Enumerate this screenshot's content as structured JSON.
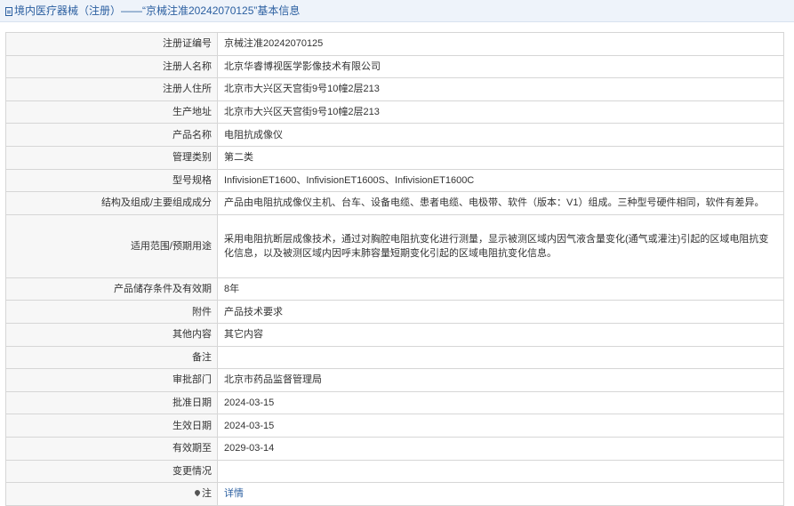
{
  "header": {
    "title": "境内医疗器械（注册）——“京械注准20242070125”基本信息",
    "icon": "document-icon"
  },
  "rows": [
    {
      "label": "注册证编号",
      "value": "京械注准20242070125"
    },
    {
      "label": "注册人名称",
      "value": "北京华睿博视医学影像技术有限公司"
    },
    {
      "label": "注册人住所",
      "value": "北京市大兴区天宫街9号10幢2层213"
    },
    {
      "label": "生产地址",
      "value": "北京市大兴区天宫街9号10幢2层213"
    },
    {
      "label": "产品名称",
      "value": "电阻抗成像仪"
    },
    {
      "label": "管理类别",
      "value": "第二类"
    },
    {
      "label": "型号规格",
      "value": "InfivisionET1600、InfivisionET1600S、InfivisionET1600C"
    },
    {
      "label": "结构及组成/主要组成成分",
      "value": "产品由电阻抗成像仪主机、台车、设备电缆、患者电缆、电极带、软件（版本：V1）组成。三种型号硬件相同，软件有差异。"
    },
    {
      "label": "适用范围/预期用途",
      "value": "采用电阻抗断层成像技术，通过对胸腔电阻抗变化进行测量，显示被测区域内因气液含量变化(通气或灌注)引起的区域电阻抗变化信息，以及被测区域内因呼末肺容量短期变化引起的区域电阻抗变化信息。"
    },
    {
      "label": "产品储存条件及有效期",
      "value": "8年"
    },
    {
      "label": "附件",
      "value": "产品技术要求"
    },
    {
      "label": "其他内容",
      "value": "其它内容"
    },
    {
      "label": "备注",
      "value": ""
    },
    {
      "label": "审批部门",
      "value": "北京市药品监督管理局"
    },
    {
      "label": "批准日期",
      "value": "2024-03-15"
    },
    {
      "label": "生效日期",
      "value": "2024-03-15"
    },
    {
      "label": "有效期至",
      "value": "2029-03-14"
    },
    {
      "label": "变更情况",
      "value": ""
    }
  ],
  "note": {
    "label": "注",
    "link": "详情",
    "icon": "pin-icon"
  }
}
